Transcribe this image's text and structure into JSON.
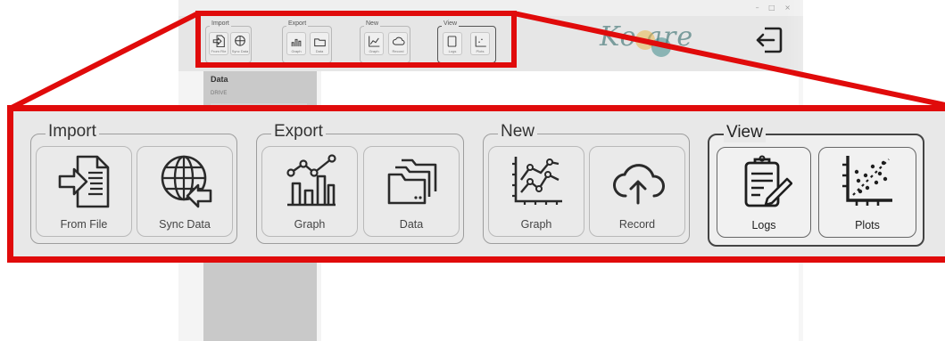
{
  "colors": {
    "callout_red": "#e00b0b",
    "toolbar_bg": "#e8e8e8",
    "sidebar_bg": "#c9c9c9",
    "logo_teal": "#7a9c9c"
  },
  "app": {
    "logo_text": "Ko are",
    "sidebar": {
      "title": "Data",
      "field_label": "DRIVE"
    }
  },
  "ribbon": {
    "groups": [
      {
        "label": "Import",
        "buttons": [
          {
            "label": "From File",
            "icon": "import-file-icon"
          },
          {
            "label": "Sync Data",
            "icon": "sync-data-globe-icon"
          }
        ]
      },
      {
        "label": "Export",
        "buttons": [
          {
            "label": "Graph",
            "icon": "export-graph-icon"
          },
          {
            "label": "Data",
            "icon": "export-data-folders-icon"
          }
        ]
      },
      {
        "label": "New",
        "buttons": [
          {
            "label": "Graph",
            "icon": "new-graph-icon"
          },
          {
            "label": "Record",
            "icon": "cloud-upload-icon"
          }
        ]
      },
      {
        "label": "View",
        "buttons": [
          {
            "label": "Logs",
            "icon": "clipboard-pencil-icon"
          },
          {
            "label": "Plots",
            "icon": "scatter-plot-icon"
          }
        ]
      }
    ]
  }
}
